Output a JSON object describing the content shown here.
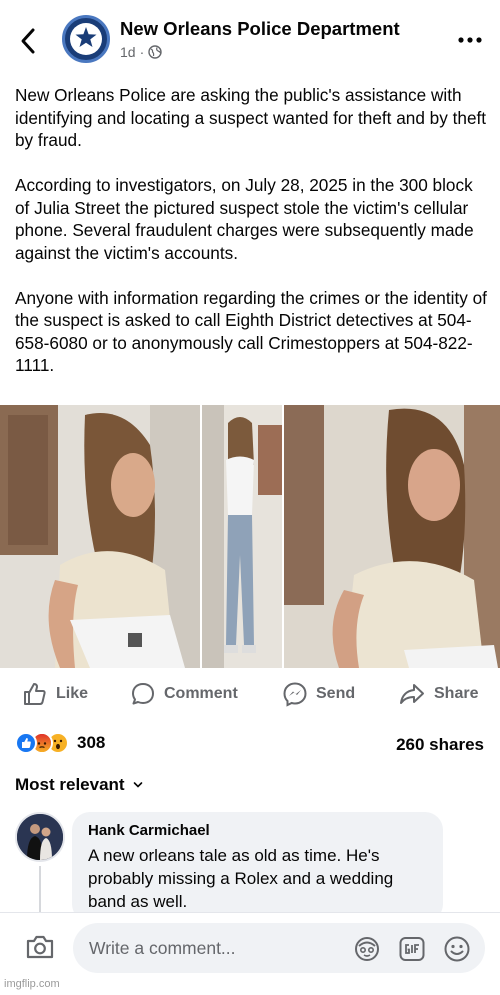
{
  "header": {
    "page_name": "New Orleans Police Department",
    "time_ago": "1d",
    "separator": "·"
  },
  "post": {
    "paragraphs": [
      "New Orleans Police are asking the public's assistance with identifying and locating a suspect wanted for theft and by theft by fraud.",
      "According to investigators, on July 28, 2025 in the 300 block of Julia Street the pictured suspect stole the victim's cellular phone. Several fraudulent charges were subsequently made against the victim's accounts.",
      "Anyone with information regarding the crimes or the identity of the suspect is asked to call Eighth District detectives at 504-658-6080 or to anonymously call Crimestoppers at 504-822-1111."
    ]
  },
  "actions": {
    "like": "Like",
    "comment": "Comment",
    "send": "Send",
    "share": "Share"
  },
  "stats": {
    "reaction_count": "308",
    "shares": "260 shares",
    "reactions": [
      "like",
      "angry",
      "wow"
    ]
  },
  "comments": {
    "sort_label": "Most relevant",
    "items": [
      {
        "author": "Hank Carmichael",
        "text": "A new orleans tale as old as time. He's probably missing a Rolex and a wedding band as well."
      }
    ]
  },
  "composer": {
    "placeholder": "Write a comment..."
  },
  "watermark": "imgflip.com",
  "colors": {
    "text": "#050505",
    "secondary": "#65676b",
    "bubble": "#f0f2f5",
    "brand_blue": "#1877f2"
  }
}
